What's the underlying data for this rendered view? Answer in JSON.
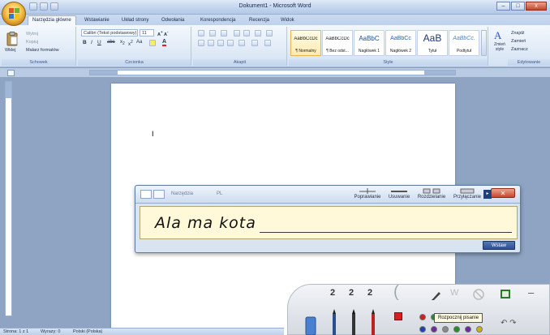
{
  "window": {
    "title": "Dokument1 - Microsoft Word",
    "controls": {
      "minimize": "–",
      "maximize": "□",
      "close": "x"
    }
  },
  "tabs": [
    "Narzędzia główne",
    "Wstawianie",
    "Układ strony",
    "Odwołania",
    "Korespondencja",
    "Recenzja",
    "Widok"
  ],
  "ribbon": {
    "clipboard": {
      "paste": "Wklej",
      "cut": "Wytnij",
      "copy": "Kopiuj",
      "format_painter": "Malarz formatów",
      "label": "Schowek"
    },
    "font": {
      "font_name": "Calibri (Tekst podstawowy)",
      "font_size": "11",
      "label": "Czcionka"
    },
    "paragraph": {
      "label": "Akapit"
    },
    "styles": {
      "items": [
        {
          "preview": "AaBbCcDc",
          "name": "¶ Normalny"
        },
        {
          "preview": "AaBbCcDc",
          "name": "¶ Bez odst..."
        },
        {
          "preview": "AaBbC",
          "name": "Nagłówek 1"
        },
        {
          "preview": "AaBbCc",
          "name": "Nagłówek 2"
        },
        {
          "preview": "AaB",
          "name": "Tytuł"
        },
        {
          "preview": "AaBbCc.",
          "name": "Podtytuł"
        }
      ],
      "change_styles": "Zmień style",
      "label": "Style"
    },
    "editing": {
      "find": "Znajdź",
      "replace": "Zamień",
      "select": "Zaznacz",
      "label": "Edytowanie"
    }
  },
  "statusbar": {
    "page": "Strona: 1 z 1",
    "words": "Wyrazy: 0",
    "language": "Polski (Polska)"
  },
  "input_panel": {
    "tools": "Narzędzia",
    "language": "PL",
    "actions": [
      "Poprawianie",
      "Usuwanie",
      "Rozdzielanie",
      "Przyłączanie"
    ],
    "ink_text": "Ala  ma  kota",
    "insert": "Wstaw"
  },
  "pen_toolbar": {
    "pen_sizes": [
      "2",
      "2",
      "2"
    ],
    "tooltip": "Rozpocznij pisanie",
    "colors": [
      "#cc1f1f",
      "#2a8a2a",
      "#1f3fb0",
      "#6a2a9a",
      "#8a8a8a",
      "#2a8a2a",
      "#6a2a9a",
      "#c8b21a"
    ]
  }
}
